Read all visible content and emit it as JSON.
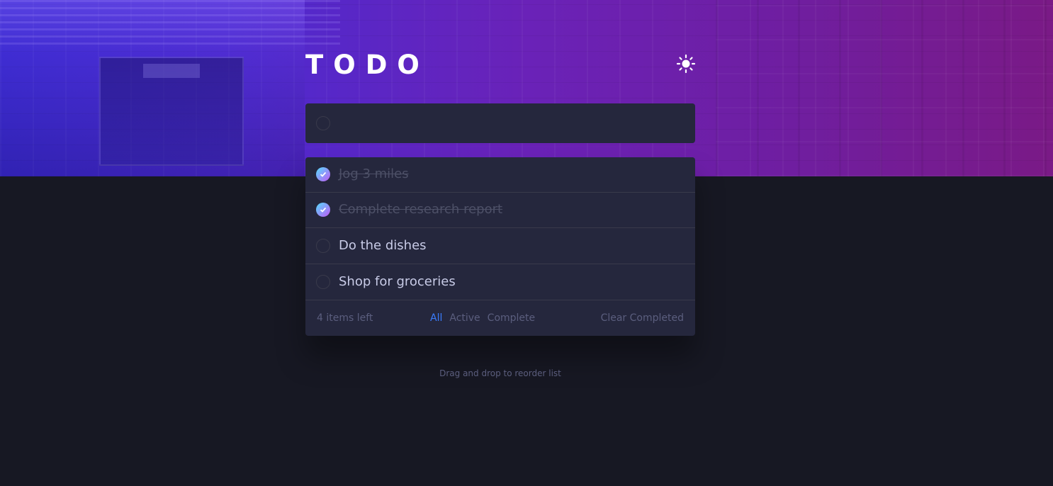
{
  "app": {
    "title": "TODO",
    "theme_toggle_icon": "sun-icon"
  },
  "new_todo": {
    "placeholder": "",
    "value": ""
  },
  "todos": [
    {
      "text": "Jog 3 miles",
      "completed": true
    },
    {
      "text": "Complete research report",
      "completed": true
    },
    {
      "text": "Do the dishes",
      "completed": false
    },
    {
      "text": "Shop for groceries",
      "completed": false
    }
  ],
  "footer": {
    "items_left": "4 items left",
    "filters": [
      "All",
      "Active",
      "Complete"
    ],
    "active_filter": "All",
    "clear_label": "Clear Completed"
  },
  "hint": "Drag and drop to reorder list",
  "colors": {
    "background": "#171823",
    "card": "#25273d",
    "accent": "#3a7cfd",
    "check_gradient_start": "#55ddff",
    "check_gradient_end": "#c058f3"
  }
}
